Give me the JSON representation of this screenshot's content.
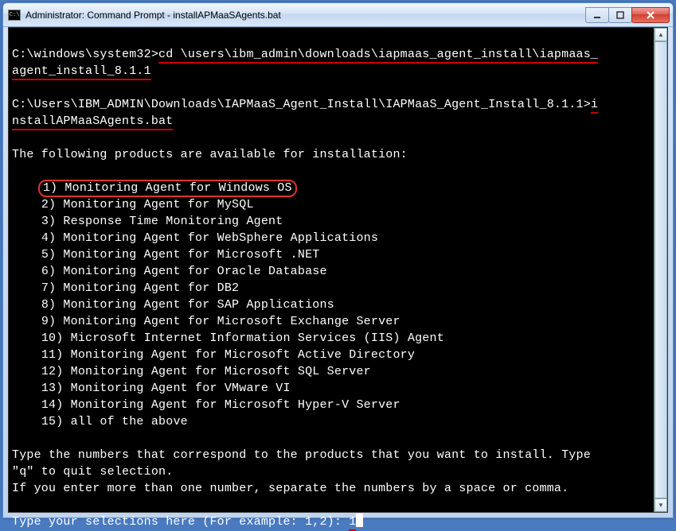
{
  "window": {
    "title": "Administrator: Command Prompt - installAPMaaSAgents.bat",
    "icon_label": "C:\\"
  },
  "terminal": {
    "prompt1_path": "C:\\windows\\system32>",
    "prompt1_cmd": "cd \\users\\ibm_admin\\downloads\\iapmaas_agent_install\\iapmaas_agent_install_8.1.1",
    "prompt2_path": "C:\\Users\\IBM_ADMIN\\Downloads\\IAPMaaS_Agent_Install\\IAPMaaS_Agent_Install_8.1.1>",
    "prompt2_cmd": "installAPMaaSAgents.bat",
    "intro": "The following products are available for installation:",
    "options": [
      "1) Monitoring Agent for Windows OS",
      "2) Monitoring Agent for MySQL",
      "3) Response Time Monitoring Agent",
      "4) Monitoring Agent for WebSphere Applications",
      "5) Monitoring Agent for Microsoft .NET",
      "6) Monitoring Agent for Oracle Database",
      "7) Monitoring Agent for DB2",
      "8) Monitoring Agent for SAP Applications",
      "9) Monitoring Agent for Microsoft Exchange Server",
      "10) Microsoft Internet Information Services (IIS) Agent",
      "11) Monitoring Agent for Microsoft Active Directory",
      "12) Monitoring Agent for Microsoft SQL Server",
      "13) Monitoring Agent for VMware VI",
      "14) Monitoring Agent for Microsoft Hyper-V Server",
      "15) all of the above"
    ],
    "instr1": "Type the numbers that correspond to the products that you want to install. Type\n\"q\" to quit selection.",
    "instr2": "If you enter more than one number, separate the numbers by a space or comma.",
    "prompt_label": "Type your selections here (For example: 1,2): ",
    "prompt_value": "1"
  }
}
